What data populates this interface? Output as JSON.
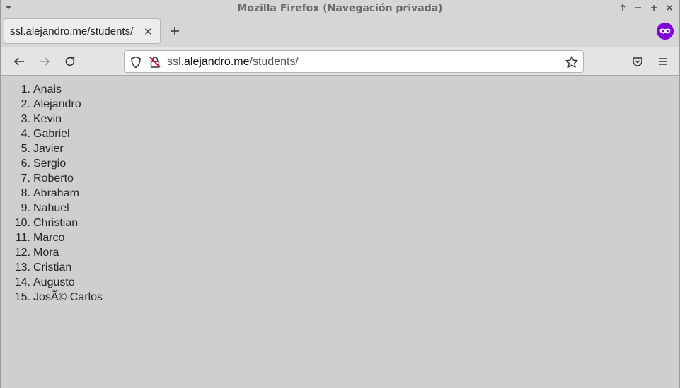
{
  "window": {
    "title": "Mozilla Firefox (Navegación privada)"
  },
  "tab": {
    "label": "ssl.alejandro.me/students/"
  },
  "address": {
    "prefix": "ssl.",
    "domain": "alejandro.me",
    "path": "/students/"
  },
  "students": [
    {
      "num": "1.",
      "name": "Anais"
    },
    {
      "num": "2.",
      "name": "Alejandro"
    },
    {
      "num": "3.",
      "name": "Kevin"
    },
    {
      "num": "4.",
      "name": "Gabriel"
    },
    {
      "num": "5.",
      "name": "Javier"
    },
    {
      "num": "6.",
      "name": "Sergio"
    },
    {
      "num": "7.",
      "name": "Roberto"
    },
    {
      "num": "8.",
      "name": "Abraham"
    },
    {
      "num": "9.",
      "name": "Nahuel"
    },
    {
      "num": "10.",
      "name": "Christian"
    },
    {
      "num": "11.",
      "name": "Marco"
    },
    {
      "num": "12.",
      "name": "Mora"
    },
    {
      "num": "13.",
      "name": "Cristian"
    },
    {
      "num": "14.",
      "name": "Augusto"
    },
    {
      "num": "15.",
      "name": "JosÃ© Carlos"
    }
  ],
  "icons": {
    "window_menu": "chevron-down-icon",
    "maximize": "arrow-up-icon",
    "minimize": "minus-icon",
    "restore": "plus-icon",
    "close": "close-icon",
    "tab_close": "close-icon",
    "new_tab": "plus-icon",
    "private": "private-browsing-mask-icon",
    "back": "arrow-left-icon",
    "forward": "arrow-right-icon",
    "reload": "reload-icon",
    "tracking_protection": "shield-icon",
    "insecure": "insecure-lock-icon",
    "bookmark": "star-icon",
    "pocket": "pocket-icon",
    "menu": "hamburger-icon"
  },
  "colors": {
    "private_badge": "#8000d7",
    "insecure_lock": "#d70022",
    "content_bg": "#cfcfcf"
  }
}
